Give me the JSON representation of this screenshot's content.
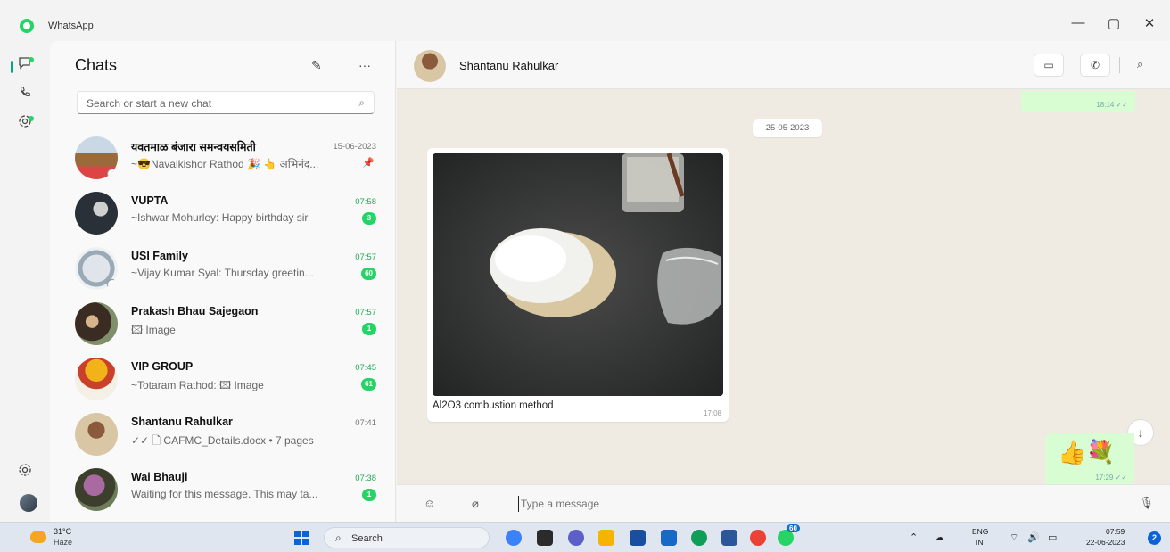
{
  "window": {
    "title": "WhatsApp",
    "minimize": "—",
    "maximize": "▢",
    "close": "✕"
  },
  "rail": {
    "icons": [
      "chats-icon",
      "calls-icon",
      "status-icon",
      "settings-icon"
    ]
  },
  "chatlist": {
    "title": "Chats",
    "new_chat_glyph": "✎",
    "menu_glyph": "···",
    "search_placeholder": "Search or start a new chat",
    "items": [
      {
        "name": "यवतमाळ बंजारा समन्वयसमिती",
        "time": "15-06-2023",
        "message": "~😎Navalkishor Rathod 🎉 👆 अभिनंद...",
        "badge": "",
        "pinned": true,
        "unread": false
      },
      {
        "name": "VUPTA",
        "time": "07:58",
        "message": "~Ishwar Mohurley: Happy birthday sir",
        "badge": "3",
        "pinned": false,
        "unread": true
      },
      {
        "name": "USI Family",
        "time": "07:57",
        "message": "~Vijay Kumar Syal: Thursday greetin...",
        "badge": "60",
        "pinned": false,
        "unread": true
      },
      {
        "name": "Prakash Bhau Sajegaon",
        "time": "07:57",
        "message": "🖾 Image",
        "badge": "1",
        "pinned": false,
        "unread": true
      },
      {
        "name": "VIP GROUP",
        "time": "07:45",
        "message": "~Totaram Rathod: 🖾 Image",
        "badge": "61",
        "pinned": false,
        "unread": true
      },
      {
        "name": "Shantanu Rahulkar",
        "time": "07:41",
        "message": "✓✓ 🗋 CAFMC_Details.docx • 7 pages",
        "badge": "",
        "pinned": false,
        "unread": false
      },
      {
        "name": "Wai Bhauji",
        "time": "07:38",
        "message": "Waiting for this message. This may ta...",
        "badge": "1",
        "pinned": false,
        "unread": true
      }
    ]
  },
  "conversation": {
    "contact_name": "Shantanu Rahulkar",
    "top_bubble_time": "18:14 ✓✓",
    "date_label": "25-05-2023",
    "image_caption": "Al2O3 combustion method",
    "image_time": "17:08",
    "sticker_time": "17:29 ✓✓",
    "sticker_glyph": "👍💐",
    "composer_placeholder": "Type a message"
  },
  "taskbar": {
    "temperature": "31°C",
    "weather": "Haze",
    "search_label": "Search",
    "whatsapp_badge": "60",
    "lang_top": "ENG",
    "lang_bottom": "IN",
    "time": "07:59",
    "date": "22-06-2023",
    "notification_count": "2"
  }
}
